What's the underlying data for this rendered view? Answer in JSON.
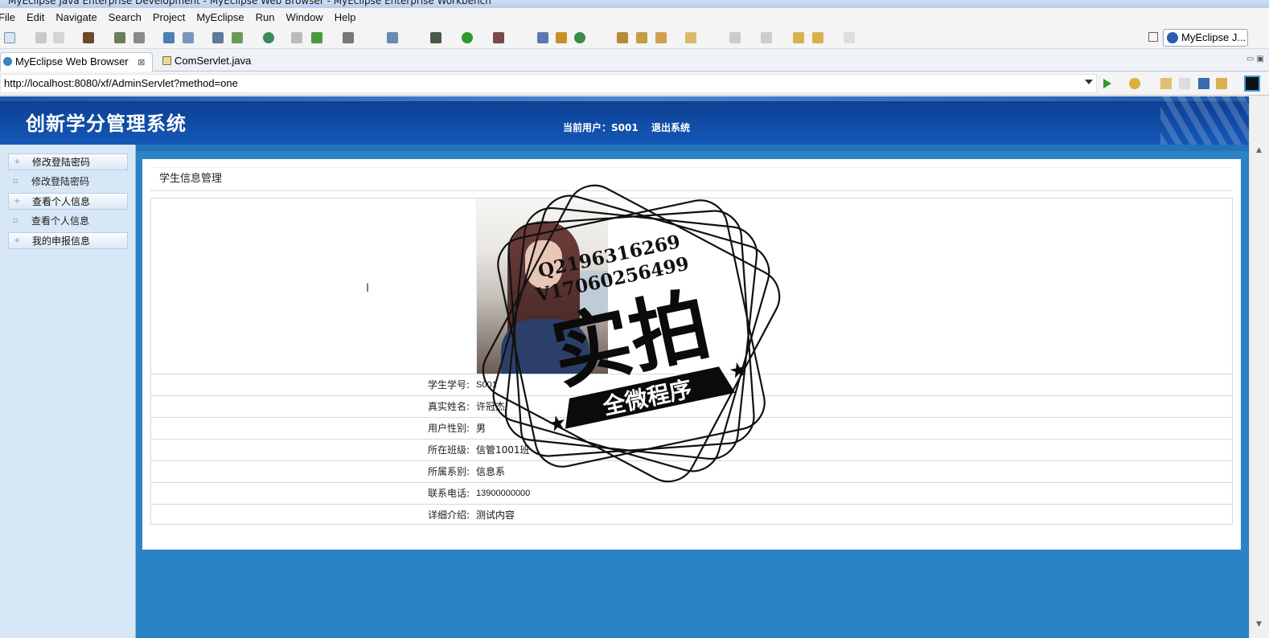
{
  "window": {
    "title": "MyEclipse Java Enterprise Development - MyEclipse Web Browser - MyEclipse Enterprise Workbench"
  },
  "menu": [
    "File",
    "Edit",
    "Navigate",
    "Search",
    "Project",
    "MyEclipse",
    "Run",
    "Window",
    "Help"
  ],
  "perspective": {
    "label": "MyEclipse J..."
  },
  "tabs": [
    {
      "label": "MyEclipse Web Browser",
      "active": true,
      "close": "⊠"
    },
    {
      "label": "ComServlet.java",
      "active": false
    }
  ],
  "address": {
    "url": "http://localhost:8080/xf/AdminServlet?method=one"
  },
  "site": {
    "title": "创新学分管理系统",
    "current_user": "当前用户：S001",
    "logout": "退出系统"
  },
  "sidebar": {
    "items": [
      {
        "label": "修改登陆密码",
        "type": "group"
      },
      {
        "label": "修改登陆密码",
        "type": "leaf"
      },
      {
        "label": "查看个人信息",
        "type": "group"
      },
      {
        "label": "查看个人信息",
        "type": "leaf"
      },
      {
        "label": "我的申报信息",
        "type": "group"
      }
    ]
  },
  "panel": {
    "title": "学生信息管理",
    "fields": [
      {
        "label": "学生学号:",
        "value": "S001"
      },
      {
        "label": "真实姓名:",
        "value": "许冠杰"
      },
      {
        "label": "用户性别:",
        "value": "男"
      },
      {
        "label": "所在班级:",
        "value": "信管1001班"
      },
      {
        "label": "所属系别:",
        "value": "信息系"
      },
      {
        "label": "联系电话:",
        "value": "13900000000"
      },
      {
        "label": "详细介绍:",
        "value": "测试内容"
      }
    ]
  },
  "watermark": {
    "line1": "Q2196316269",
    "line2": "V17060256499",
    "big": "实拍",
    "banner": "全微程序"
  },
  "colors": {
    "header": "#0f4aa3",
    "page_bg": "#2a83c4",
    "sidebar_bg": "#d7e7f6"
  }
}
